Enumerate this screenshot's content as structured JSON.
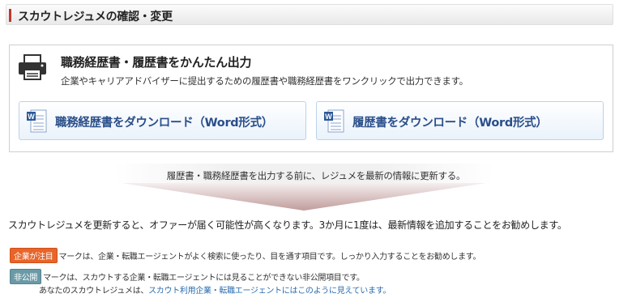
{
  "header": {
    "title": "スカウトレジュメの確認・変更",
    "accent_color": "#c0392b"
  },
  "output_section": {
    "title": "職務経歴書・履歴書をかんたん出力",
    "description": "企業やキャリアアドバイザーに提出するための履歴書や職務経歴書をワンクリックで出力できます。",
    "icon": "printer-icon",
    "buttons": [
      {
        "label": "職務経歴書をダウンロード（Word形式）",
        "icon": "word-document-icon"
      },
      {
        "label": "履歴書をダウンロード（Word形式）",
        "icon": "word-document-icon"
      }
    ]
  },
  "notice": "履歴書・職務経歴書を出力する前に、レジュメを最新の情報に更新する。",
  "paragraph": "スカウトレジュメを更新すると、オファーが届く可能性が高くなります。3か月に1度は、最新情報を追加することをお勧めします。",
  "tags": {
    "company_badge": "企業が注目",
    "company_text": "マークは、企業・転職エージェントがよく検索に使ったり、目を通す項目です。しっかり入力することをお勧めします。",
    "private_badge": "非公開",
    "private_text": "マークは、スカウトする企業・転職エージェントには見ることができない非公開項目です。",
    "sub_prefix": "あなたのスカウトレジュメは、",
    "sub_link": "スカウト利用企業・転職エージェントにはこのように見えています。",
    "company_color": "#e8652a",
    "private_color": "#6a9aa6",
    "link_color": "#2b6cb0"
  }
}
